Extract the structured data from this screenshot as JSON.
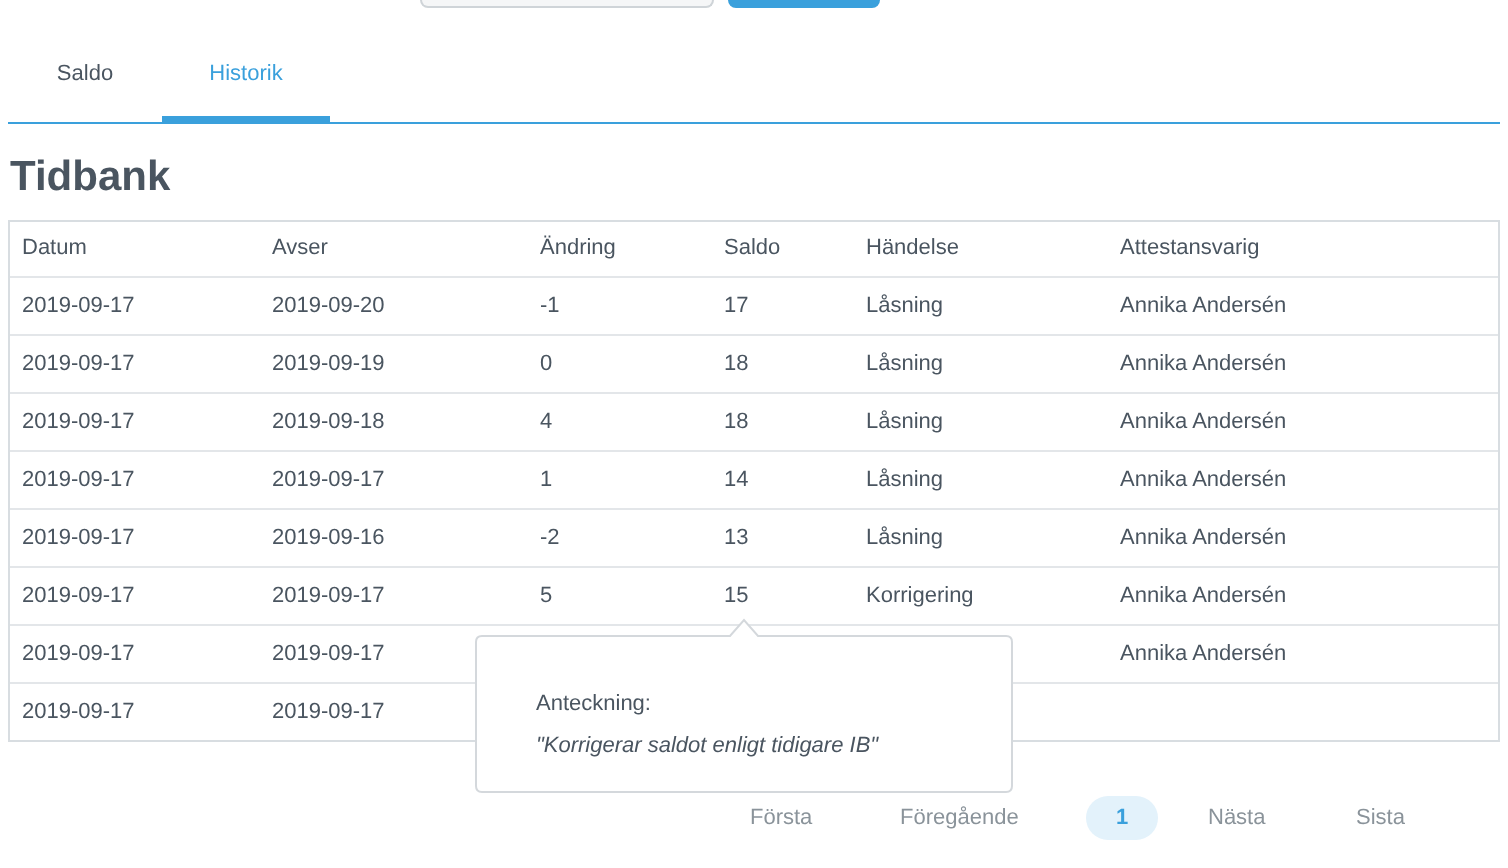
{
  "tabs": [
    {
      "label": "Saldo",
      "selected": false
    },
    {
      "label": "Historik",
      "selected": true
    }
  ],
  "title": "Tidbank",
  "table": {
    "columns": [
      "Datum",
      "Avser",
      "Ändring",
      "Saldo",
      "Händelse",
      "Attestansvarig"
    ],
    "rows": [
      [
        "2019-09-17",
        "2019-09-20",
        "-1",
        "17",
        "Låsning",
        "Annika Andersén"
      ],
      [
        "2019-09-17",
        "2019-09-19",
        "0",
        "18",
        "Låsning",
        "Annika Andersén"
      ],
      [
        "2019-09-17",
        "2019-09-18",
        "4",
        "18",
        "Låsning",
        "Annika Andersén"
      ],
      [
        "2019-09-17",
        "2019-09-17",
        "1",
        "14",
        "Låsning",
        "Annika Andersén"
      ],
      [
        "2019-09-17",
        "2019-09-16",
        "-2",
        "13",
        "Låsning",
        "Annika Andersén"
      ],
      [
        "2019-09-17",
        "2019-09-17",
        "5",
        "15",
        "Korrigering",
        "Annika Andersén"
      ],
      [
        "2019-09-17",
        "2019-09-17",
        null,
        null,
        null,
        "Annika Andersén"
      ],
      [
        "2019-09-17",
        "2019-09-17",
        null,
        null,
        null,
        null
      ]
    ]
  },
  "popover": {
    "label": "Anteckning:",
    "note": "\"Korrigerar saldot enligt tidigare IB\""
  },
  "pagination": [
    {
      "label": "Första",
      "selected": false
    },
    {
      "label": "Föregående",
      "selected": false
    },
    {
      "label": "1",
      "selected": true
    },
    {
      "label": "Nästa",
      "selected": false
    },
    {
      "label": "Sista",
      "selected": false
    }
  ]
}
